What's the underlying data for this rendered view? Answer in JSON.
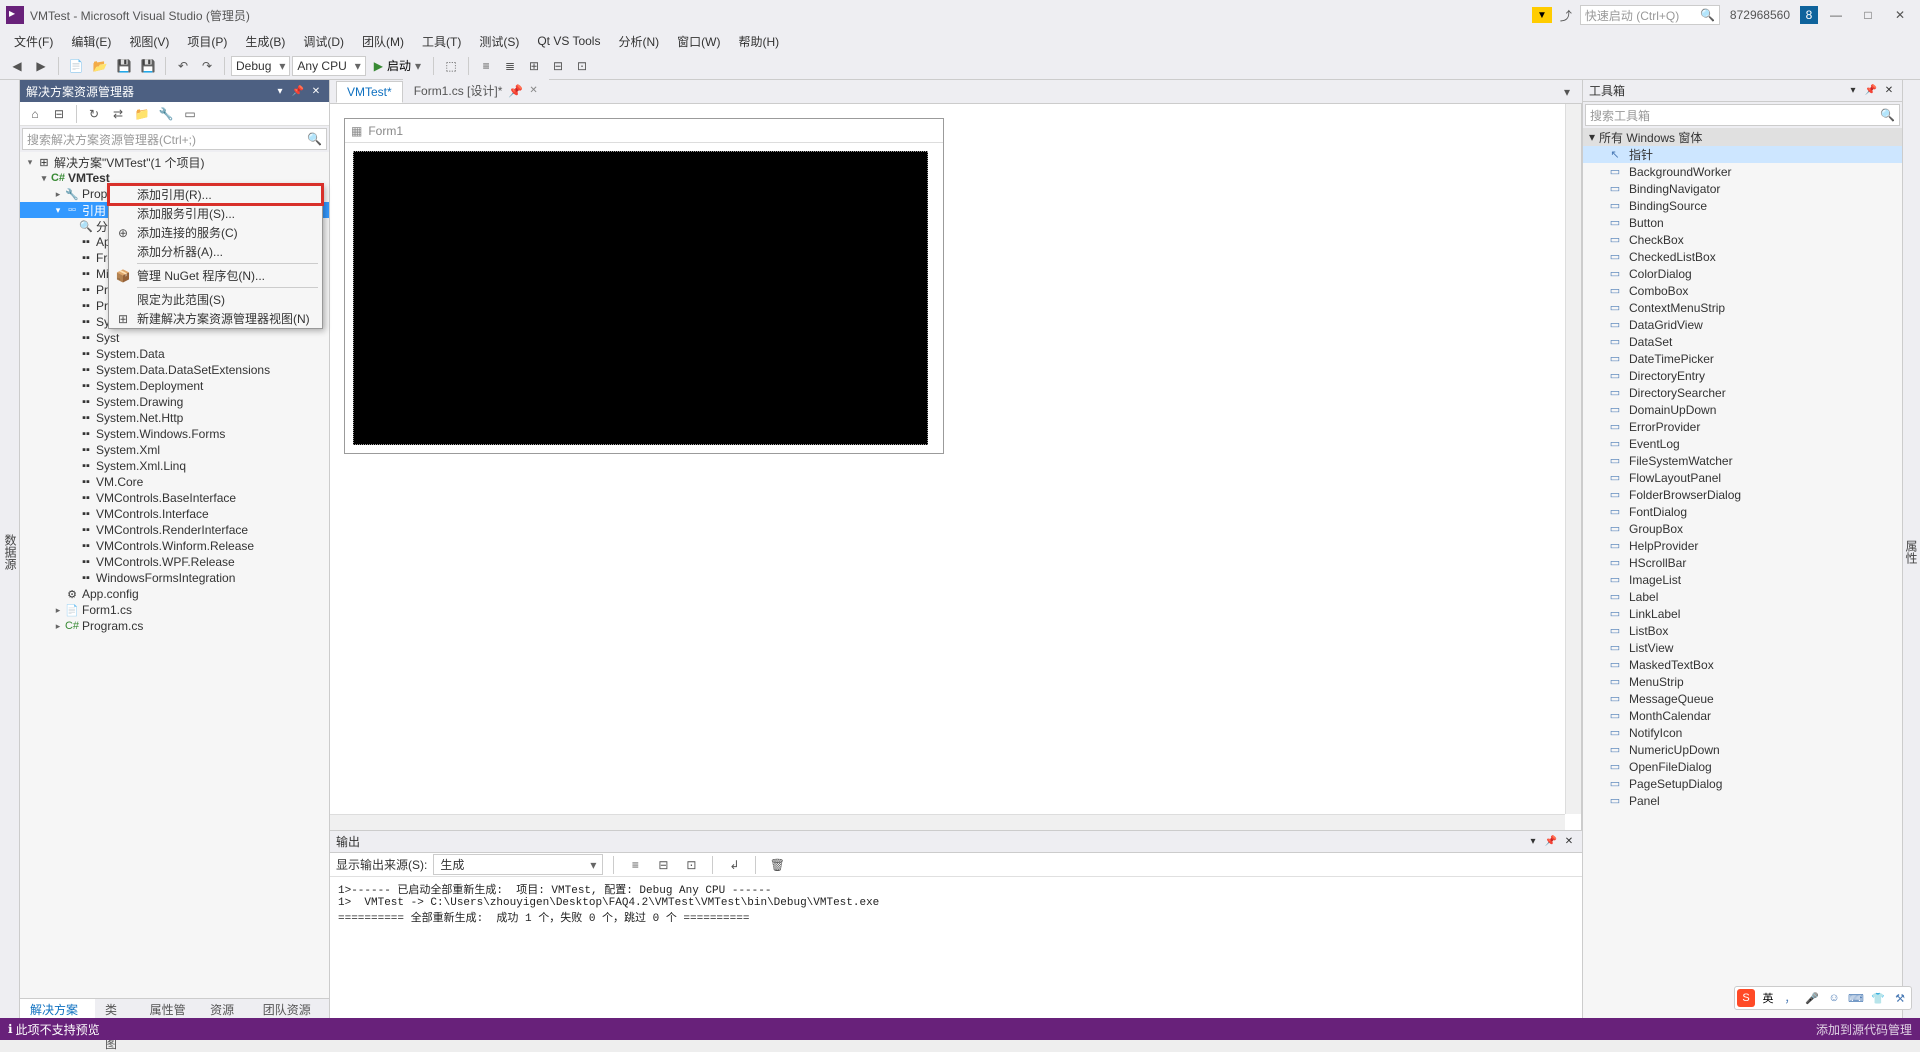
{
  "title": "VMTest - Microsoft Visual Studio  (管理员)",
  "quick_launch_placeholder": "快速启动 (Ctrl+Q)",
  "user_count": "872968560",
  "notif_count": "8",
  "menus": [
    "文件(F)",
    "编辑(E)",
    "视图(V)",
    "项目(P)",
    "生成(B)",
    "调试(D)",
    "团队(M)",
    "工具(T)",
    "测试(S)",
    "Qt VS Tools",
    "分析(N)",
    "窗口(W)",
    "帮助(H)"
  ],
  "toolbar": {
    "config": "Debug",
    "platform": "Any CPU",
    "start": "启动"
  },
  "sol_explorer": {
    "title": "解决方案资源管理器",
    "search_placeholder": "搜索解决方案资源管理器(Ctrl+;)",
    "solution_label": "解决方案\"VMTest\"(1 个项目)",
    "project": "VMTest",
    "nodes": [
      "Properties",
      "引用",
      "分析",
      "App",
      "Fror",
      "Micr",
      "Pres",
      "Pres",
      "Syst",
      "Syst",
      "System.Data",
      "System.Data.DataSetExtensions",
      "System.Deployment",
      "System.Drawing",
      "System.Net.Http",
      "System.Windows.Forms",
      "System.Xml",
      "System.Xml.Linq",
      "VM.Core",
      "VMControls.BaseInterface",
      "VMControls.Interface",
      "VMControls.RenderInterface",
      "VMControls.Winform.Release",
      "VMControls.WPF.Release",
      "WindowsFormsIntegration"
    ],
    "files": [
      "App.config",
      "Form1.cs",
      "Program.cs"
    ],
    "bottom_tabs": [
      "解决方案资源...",
      "类视图",
      "属性管理器",
      "资源视图",
      "团队资源管理器"
    ]
  },
  "context_menu": {
    "items": [
      "添加引用(R)...",
      "添加服务引用(S)...",
      "添加连接的服务(C)",
      "添加分析器(A)...",
      "管理 NuGet 程序包(N)...",
      "限定为此范围(S)",
      "新建解决方案资源管理器视图(N)"
    ]
  },
  "tabs": [
    {
      "label": "VMTest*",
      "active": true
    },
    {
      "label": "Form1.cs [设计]*",
      "active": false,
      "pinned": true
    }
  ],
  "form_title": "Form1",
  "output": {
    "title": "输出",
    "source_label": "显示输出来源(S):",
    "source_value": "生成",
    "lines": [
      "1>------ 已启动全部重新生成:  项目: VMTest, 配置: Debug Any CPU ------",
      "1>  VMTest -> C:\\Users\\zhouyigen\\Desktop\\FAQ4.2\\VMTest\\VMTest\\bin\\Debug\\VMTest.exe",
      "========== 全部重新生成:  成功 1 个，失败 0 个，跳过 0 个 =========="
    ]
  },
  "toolbox": {
    "title": "工具箱",
    "search_placeholder": "搜索工具箱",
    "category": "所有 Windows 窗体",
    "items": [
      "指针",
      "BackgroundWorker",
      "BindingNavigator",
      "BindingSource",
      "Button",
      "CheckBox",
      "CheckedListBox",
      "ColorDialog",
      "ComboBox",
      "ContextMenuStrip",
      "DataGridView",
      "DataSet",
      "DateTimePicker",
      "DirectoryEntry",
      "DirectorySearcher",
      "DomainUpDown",
      "ErrorProvider",
      "EventLog",
      "FileSystemWatcher",
      "FlowLayoutPanel",
      "FolderBrowserDialog",
      "FontDialog",
      "GroupBox",
      "HelpProvider",
      "HScrollBar",
      "ImageList",
      "Label",
      "LinkLabel",
      "ListBox",
      "ListView",
      "MaskedTextBox",
      "MenuStrip",
      "MessageQueue",
      "MonthCalendar",
      "NotifyIcon",
      "NumericUpDown",
      "OpenFileDialog",
      "PageSetupDialog",
      "Panel"
    ]
  },
  "status": {
    "left": "此项不支持预览",
    "right": "添加到源代码管理"
  },
  "left_rail_label": "数据源",
  "right_rail_label": "属性",
  "ime": {
    "lang": "英"
  }
}
